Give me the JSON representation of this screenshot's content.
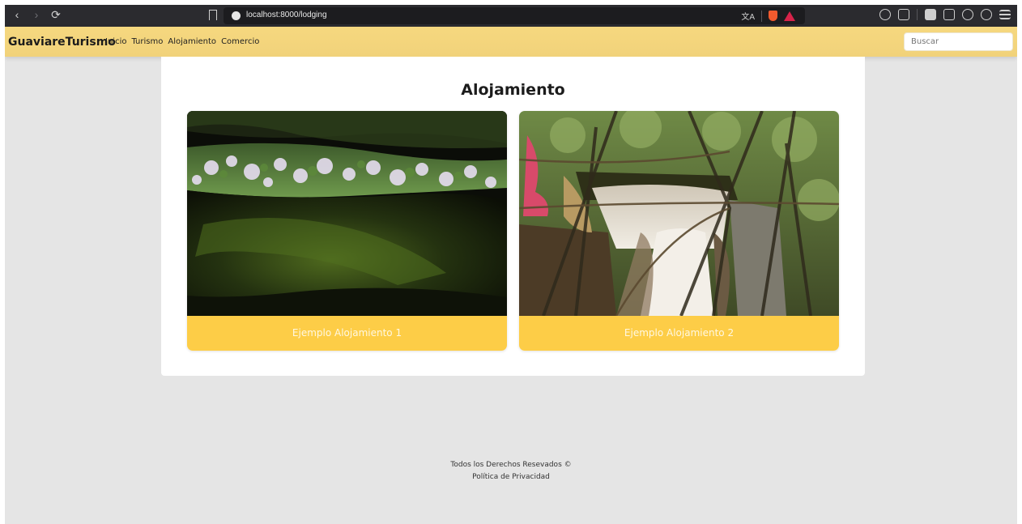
{
  "browser": {
    "url": "localhost:8000/lodging",
    "nav_back": "‹",
    "nav_forward": "›",
    "nav_reload": "⟳",
    "translate_label": "文A"
  },
  "site": {
    "brand": "GuaviareTurismo",
    "nav": [
      {
        "label": "Inicio"
      },
      {
        "label": "Turismo"
      },
      {
        "label": "Alojamiento"
      },
      {
        "label": "Comercio"
      }
    ],
    "search_placeholder": "Buscar",
    "accent_color": "#f5d680",
    "button_color": "#fdcd47"
  },
  "main": {
    "title": "Alojamiento",
    "cards": [
      {
        "label": "Ejemplo Alojamiento 1",
        "image": "forest-canopy-photo"
      },
      {
        "label": "Ejemplo Alojamiento 2",
        "image": "waterfall-photo"
      }
    ]
  },
  "footer": {
    "copyright": "Todos los Derechos Resevados ©",
    "privacy": "Política de Privacidad"
  }
}
